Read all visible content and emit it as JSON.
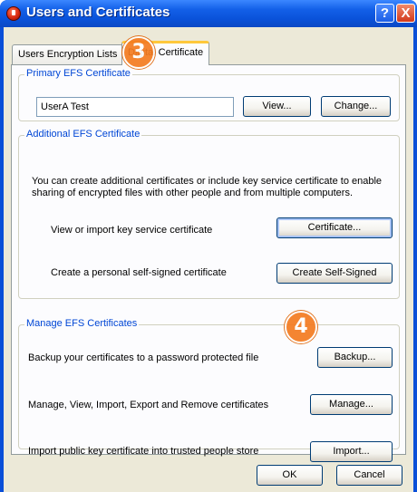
{
  "window": {
    "title": "Users and Certificates"
  },
  "title_buttons": {
    "help_label": "?",
    "close_label": "X"
  },
  "tabs": [
    {
      "label": "Users Encryption Lists"
    },
    {
      "label": "Digital Certificate"
    }
  ],
  "primary": {
    "legend": "Primary EFS Certificate",
    "value": "UserA Test",
    "view_label": "View...",
    "change_label": "Change..."
  },
  "additional": {
    "legend": "Additional EFS Certificate",
    "description": "You can create additional certificates or include key service certificate to enable sharing of encrypted files with other people and from multiple computers.",
    "view_import_text": "View or import key service certificate",
    "certificate_label": "Certificate...",
    "self_signed_text": "Create a personal self-signed certificate",
    "create_self_signed_label": "Create Self-Signed"
  },
  "manage": {
    "legend": "Manage EFS Certificates",
    "backup_text": "Backup your certificates to a password protected file",
    "backup_label": "Backup...",
    "manage_text": "Manage, View, Import, Export and Remove certificates",
    "manage_label": "Manage...",
    "import_text": "Import public key certificate into trusted people store",
    "import_label": "Import..."
  },
  "footer": {
    "ok_label": "OK",
    "cancel_label": "Cancel"
  },
  "step_badges": [
    "3",
    "4"
  ],
  "colors": {
    "titlebar": "#0a52d9",
    "dialog_bg": "#ece9d8",
    "legend_text": "#0046d5",
    "step_badge": "#f47b20",
    "active_tab_highlight": "#ffc83c"
  }
}
